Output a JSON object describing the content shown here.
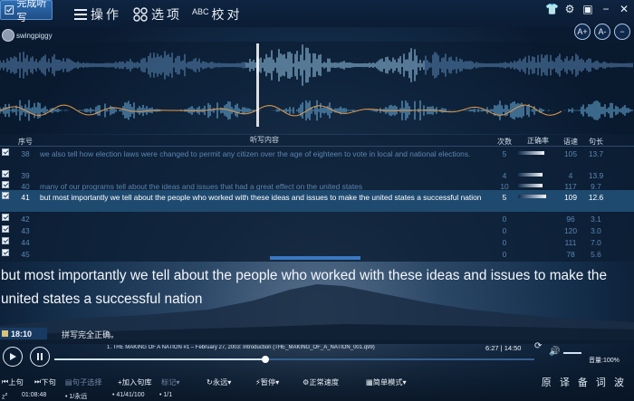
{
  "topbar": {
    "done_button": "完成听写",
    "menu_operate": "操作",
    "menu_options": "选项",
    "menu_proof": "校对",
    "menu_proof_prefix": "ABC"
  },
  "user": {
    "name": "swingpiggy"
  },
  "font_tools": {
    "increase": "A+",
    "decrease": "A-",
    "minus": "−"
  },
  "table": {
    "headers": {
      "no": "序号",
      "content": "听写内容",
      "count": "次数",
      "accuracy": "正确率",
      "wpm": "语速",
      "length": "句长"
    },
    "rows": [
      {
        "no": "38",
        "text": "we also tell how election laws were changed  to permit any citizen over the age of eighteen  to vote in  local and national elections.",
        "count": "5",
        "wpm": "105",
        "len": "13.7",
        "selected": false,
        "accuracy": 0.85
      },
      {
        "no": "39",
        "text": "",
        "count": "4",
        "wpm": "4",
        "len": "13.9",
        "selected": false,
        "accuracy": 0.8
      },
      {
        "no": "40",
        "text": "many of our programs tell about the ideas  and issues that had a great effect on the united states",
        "count": "10",
        "wpm": "117",
        "len": "9.7",
        "selected": false,
        "accuracy": 0.8
      },
      {
        "no": "41",
        "text": "but most importantly we tell about the people who worked with these ideas and issues to make the united states a successful nation",
        "count": "5",
        "wpm": "109",
        "len": "12.6",
        "selected": true,
        "accuracy": 0.9
      },
      {
        "no": "42",
        "text": "",
        "count": "0",
        "wpm": "96",
        "len": "3.1",
        "selected": false,
        "accuracy": 0
      },
      {
        "no": "43",
        "text": "",
        "count": "0",
        "wpm": "120",
        "len": "3.0",
        "selected": false,
        "accuracy": 0
      },
      {
        "no": "44",
        "text": "",
        "count": "0",
        "wpm": "111",
        "len": "7.0",
        "selected": false,
        "accuracy": 0
      },
      {
        "no": "45",
        "text": "",
        "count": "0",
        "wpm": "78",
        "len": "5.6",
        "selected": false,
        "accuracy": 0
      }
    ]
  },
  "subtitle": "but most importantly we tell about the people who worked with these ideas and issues to make the united states a successful nation",
  "status": {
    "time": "18:10",
    "message": "拼写完全正确。"
  },
  "player": {
    "track": "1. THE MAKING OF A NATION #1 – February 27, 2003: Introduction (THE_MAKING_OF_A_NATION_001.q99)",
    "time": "6:27 | 14:50",
    "progress": 0.44,
    "volume_label": "音量:100%"
  },
  "controls": {
    "prev": "上句",
    "next": "下句",
    "sub_select": "句子选择",
    "add_lib": "+加入句库",
    "mark": "标记",
    "repeat": "永远",
    "pause": "暂停",
    "speed": "正常速度",
    "mode": "简单模式"
  },
  "stats": {
    "elapsed": "01:08:48",
    "repeat_count": "1/永远",
    "sentences": "41/41/100",
    "page": "1/1"
  },
  "brand": "原 译 备 词 波"
}
